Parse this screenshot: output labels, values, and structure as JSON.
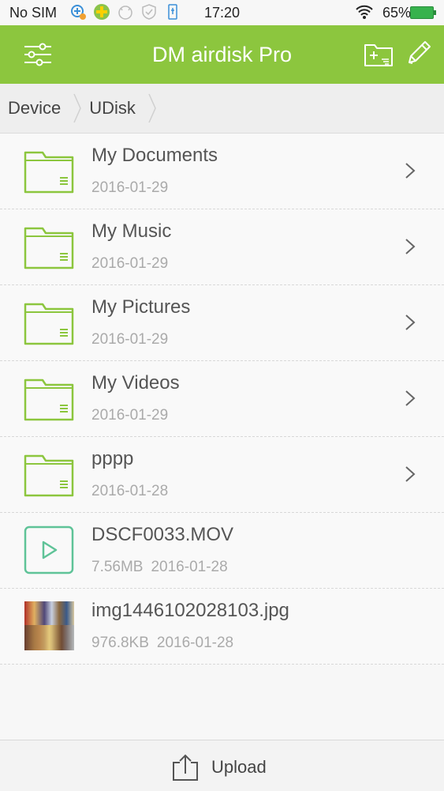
{
  "status_bar": {
    "carrier": "No SIM",
    "time": "17:20",
    "battery": "65%",
    "icons": [
      "notification-plus-icon",
      "puzzle-icon",
      "cat-icon",
      "shield-icon",
      "usb-icon"
    ]
  },
  "app_bar": {
    "title": "DM airdisk Pro",
    "color": "#8cc63e"
  },
  "breadcrumb": {
    "items": [
      "Device",
      "UDisk"
    ]
  },
  "files": [
    {
      "name": "My Documents",
      "size": "",
      "date": "2016-01-29",
      "type": "folder"
    },
    {
      "name": "My Music",
      "size": "",
      "date": "2016-01-29",
      "type": "folder"
    },
    {
      "name": "My Pictures",
      "size": "",
      "date": "2016-01-29",
      "type": "folder"
    },
    {
      "name": "My Videos",
      "size": "",
      "date": "2016-01-29",
      "type": "folder"
    },
    {
      "name": "pppp",
      "size": "",
      "date": "2016-01-28",
      "type": "folder"
    },
    {
      "name": "DSCF0033.MOV",
      "size": "7.56MB",
      "date": "2016-01-28",
      "type": "video"
    },
    {
      "name": "img1446102028103.jpg",
      "size": "976.8KB",
      "date": "2016-01-28",
      "type": "image"
    }
  ],
  "bottom_bar": {
    "upload_label": "Upload"
  }
}
